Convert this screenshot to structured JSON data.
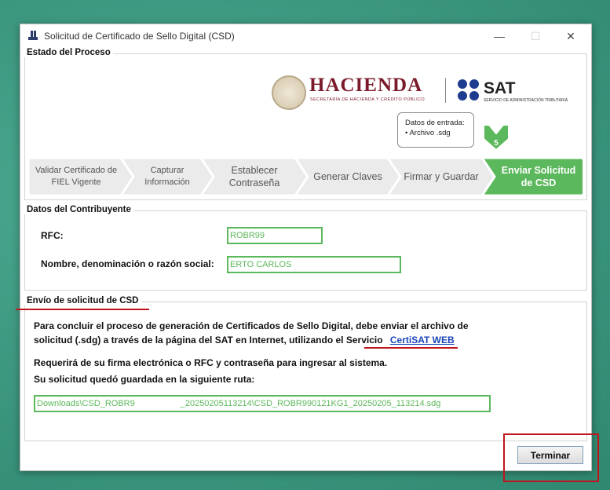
{
  "window": {
    "title": "Solicitud de Certificado de Sello Digital (CSD)",
    "controls": {
      "minimize": "—",
      "maximize": "☐",
      "close": "✕"
    }
  },
  "estado": {
    "section_title": "Estado del Proceso",
    "logos": {
      "hacienda": "HACIENDA",
      "hacienda_sub": "SECRETARÍA DE HACIENDA Y CRÉDITO PÚBLICO",
      "sat": "SAT",
      "sat_sub": "SERVICIO DE ADMINISTRACIÓN TRIBUTARIA"
    },
    "tooltip": {
      "title": "Datos de entrada:",
      "item": "• Archivo .sdg"
    },
    "current_step_number": "5",
    "steps": [
      {
        "label": "Validar Certificado de FIEL Vigente"
      },
      {
        "label": "Capturar Información"
      },
      {
        "label": "Establecer Contraseña"
      },
      {
        "label": "Generar Claves"
      },
      {
        "label": "Firmar y Guardar"
      },
      {
        "label": "Enviar Solicitud de CSD"
      }
    ],
    "active_step": 6,
    "colors": {
      "active": "#5cb85c",
      "inactive": "#ebebeb",
      "inactive_text": "#555555",
      "active_text": "#ffffff"
    }
  },
  "contribuyente": {
    "section_title": "Datos del Contribuyente",
    "rfc_label": "RFC:",
    "rfc_value": "ROBR99",
    "nombre_label": "Nombre, denominación o razón social:",
    "nombre_value": "ERTO CARLOS"
  },
  "envio": {
    "section_title": "Envío de solicitud de CSD",
    "paragraph_line1": "Para concluir el proceso de generación de Certificados de Sello Digital, debe enviar el archivo de",
    "paragraph_line2": "solicitud (.sdg) a través de la página del SAT en Internet, utilizando el Servicio",
    "link_text": "CertiSAT WEB",
    "requirement": "Requerirá de su firma electrónica o RFC y contraseña para ingresar al sistema.",
    "path_label": "Su solicitud quedó guardada en la siguiente ruta:",
    "path_start": "Downloads\\CSD_ROBR9",
    "path_end": "_20250205113214\\CSD_ROBR990121KG1_20250205_113214.sdg"
  },
  "footer": {
    "terminar_label": "Terminar"
  }
}
